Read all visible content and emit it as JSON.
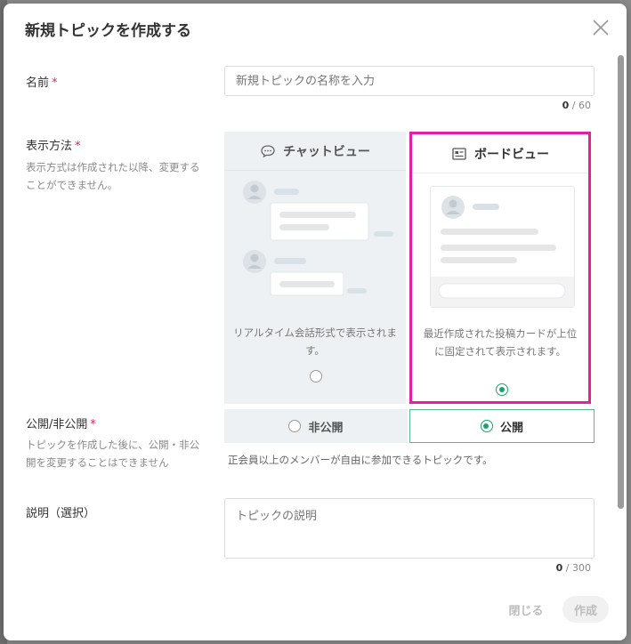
{
  "dialog": {
    "title": "新規トピックを作成する"
  },
  "name_field": {
    "label": "名前",
    "required_mark": "*",
    "placeholder": "新規トピックの名称を入力",
    "count": "0",
    "max": "/ 60"
  },
  "display_method": {
    "label": "表示方法",
    "required_mark": "*",
    "description": "表示方式は作成された以降、変更することができません。",
    "options": [
      {
        "title": "チャットビュー",
        "description": "リアルタイム会話形式で表示されます。",
        "selected": false
      },
      {
        "title": "ボードビュー",
        "description": "最近作成された投稿カードが上位に固定されて表示されます。",
        "selected": true
      }
    ]
  },
  "visibility": {
    "label": "公開/非公開",
    "required_mark": "*",
    "description": "トピックを作成した後に、公開・非公開を変更することはできません",
    "options": [
      {
        "label": "非公開",
        "selected": false
      },
      {
        "label": "公開",
        "selected": true
      }
    ],
    "note": "正会員以上のメンバーが自由に参加できるトピックです。"
  },
  "description_field": {
    "label": "説明（選択）",
    "placeholder": "トピックの説明",
    "count": "0",
    "max": "/ 300"
  },
  "footer": {
    "close_label": "閉じる",
    "create_label": "作成"
  },
  "colors": {
    "accent_green": "#1aa46a",
    "highlight_magenta": "#e31fa6",
    "required_red": "#e0245e"
  }
}
